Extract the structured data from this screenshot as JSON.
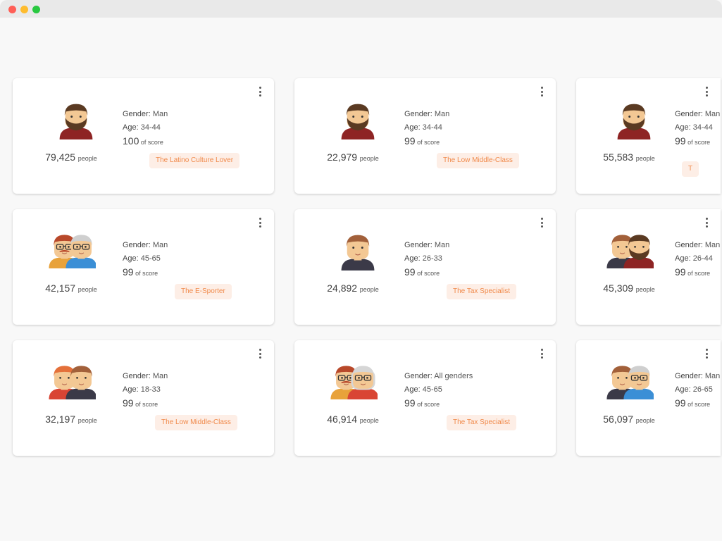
{
  "window": {
    "controls": [
      {
        "name": "close",
        "color": "#ff5f57"
      },
      {
        "name": "minimize",
        "color": "#febc2e"
      },
      {
        "name": "maximize",
        "color": "#28c840"
      }
    ]
  },
  "labels": {
    "gender": "Gender:",
    "age": "Age:",
    "score_suffix": "of score",
    "people_suffix": "people"
  },
  "cards": [
    {
      "avatar": "bearded-man",
      "gender": "Man",
      "age": "34-44",
      "score": "100",
      "people": "79,425",
      "tag": "The Latino Culture Lover"
    },
    {
      "avatar": "bearded-man",
      "gender": "Man",
      "age": "34-44",
      "score": "99",
      "people": "22,979",
      "tag": "The Low Middle-Class"
    },
    {
      "avatar": "bearded-man",
      "gender": "Man",
      "age": "34-44",
      "score": "99",
      "people": "55,583",
      "tag": "T"
    },
    {
      "avatar": "redhead-and-grey-man-pair",
      "gender": "Man",
      "age": "45-65",
      "score": "99",
      "people": "42,157",
      "tag": "The E-Sporter"
    },
    {
      "avatar": "young-man",
      "gender": "Man",
      "age": "26-33",
      "score": "99",
      "people": "24,892",
      "tag": "The Tax Specialist"
    },
    {
      "avatar": "young-and-bearded-man-pair",
      "gender": "Man",
      "age": "26-44",
      "score": "99",
      "people": "45,309",
      "tag": ""
    },
    {
      "avatar": "ginger-and-young-man-pair",
      "gender": "Man",
      "age": "18-33",
      "score": "99",
      "people": "32,197",
      "tag": "The Low Middle-Class"
    },
    {
      "avatar": "man-and-grey-woman-pair",
      "gender": "All genders",
      "age": "45-65",
      "score": "99",
      "people": "46,914",
      "tag": "The Tax Specialist"
    },
    {
      "avatar": "young-and-grey-man-pair",
      "gender": "Man",
      "age": "26-65",
      "score": "99",
      "people": "56,097",
      "tag": ""
    }
  ]
}
